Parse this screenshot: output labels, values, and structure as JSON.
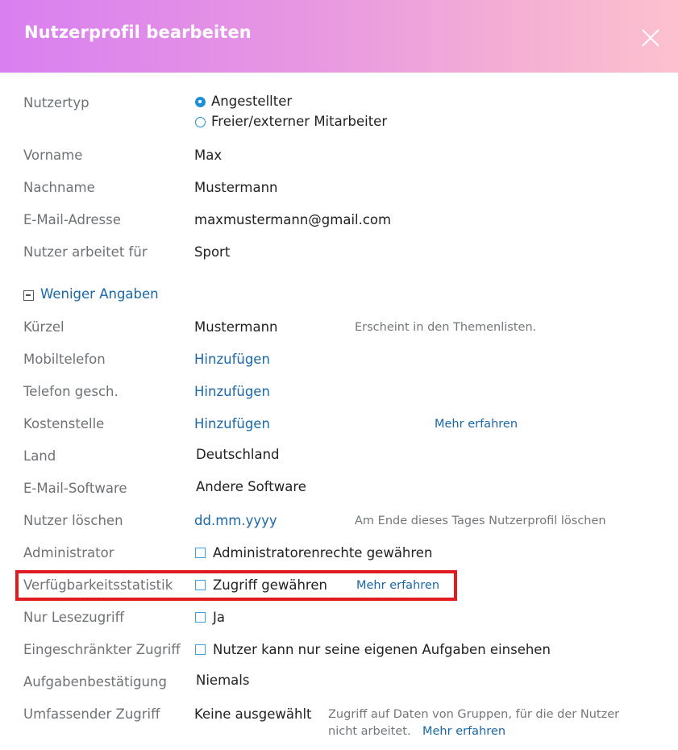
{
  "header": {
    "title": "Nutzerprofil bearbeiten"
  },
  "fields": {
    "nutzertyp": {
      "label": "Nutzertyp",
      "options": [
        "Angestellter",
        "Freier/externer Mitarbeiter"
      ],
      "selected": "Angestellter"
    },
    "vorname": {
      "label": "Vorname",
      "value": "Max"
    },
    "nachname": {
      "label": "Nachname",
      "value": "Mustermann"
    },
    "email": {
      "label": "E-Mail-Adresse",
      "value": "maxmustermann@gmail.com"
    },
    "arbeitet_fuer": {
      "label": "Nutzer arbeitet für",
      "value": "Sport"
    },
    "toggle": {
      "label": "Weniger Angaben"
    },
    "kuerzel": {
      "label": "Kürzel",
      "value": "Mustermann",
      "hint": "Erscheint in den Themenlisten."
    },
    "mobil": {
      "label": "Mobiltelefon",
      "value": "Hinzufügen"
    },
    "telefon": {
      "label": "Telefon gesch.",
      "value": "Hinzufügen"
    },
    "kostenstelle": {
      "label": "Kostenstelle",
      "value": "Hinzufügen",
      "link": "Mehr erfahren"
    },
    "land": {
      "label": "Land",
      "value": "Deutschland"
    },
    "email_software": {
      "label": "E-Mail-Software",
      "value": "Andere Software"
    },
    "loeschen": {
      "label": "Nutzer löschen",
      "value": "dd.mm.yyyy",
      "hint": "Am Ende dieses Tages Nutzerprofil löschen"
    },
    "admin": {
      "label": "Administrator",
      "checkbox_label": "Administratorenrechte gewähren",
      "checked": false
    },
    "verfuegbarkeit": {
      "label": "Verfügbarkeitsstatistik",
      "checkbox_label": "Zugriff gewähren",
      "link": "Mehr erfahren",
      "checked": false
    },
    "lesezugriff": {
      "label": "Nur Lesezugriff",
      "checkbox_label": "Ja",
      "checked": false
    },
    "eingeschraenkt": {
      "label": "Eingeschränkter Zugriff",
      "checkbox_label": "Nutzer kann nur seine eigenen Aufgaben einsehen",
      "checked": false
    },
    "bestaetigung": {
      "label": "Aufgabenbestätigung",
      "value": "Niemals"
    },
    "umfassend": {
      "label": "Umfassender Zugriff",
      "value": "Keine ausgewählt",
      "hint_line1": "Zugriff auf Daten von Gruppen, für die der Nutzer",
      "hint_line2": "nicht arbeitet.",
      "link": "Mehr erfahren"
    }
  },
  "colors": {
    "header_gradient_start": "#d97ff0",
    "header_gradient_end": "#fcc1cf",
    "link": "#1a67a7",
    "label": "#6d7276",
    "accent": "#1f8fd6",
    "highlight": "#e01b22"
  }
}
